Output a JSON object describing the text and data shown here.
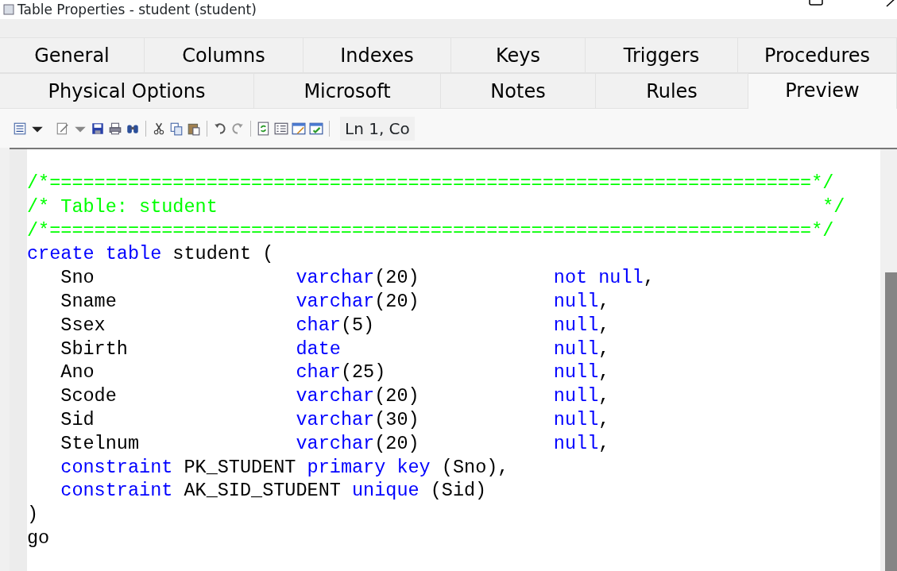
{
  "window": {
    "title": "Table Properties - student (student)"
  },
  "tab_rows": [
    [
      {
        "label": "General",
        "selected": false
      },
      {
        "label": "Columns",
        "selected": false
      },
      {
        "label": "Indexes",
        "selected": false
      },
      {
        "label": "Keys",
        "selected": false
      },
      {
        "label": "Triggers",
        "selected": false
      },
      {
        "label": "Procedures",
        "selected": false
      }
    ],
    [
      {
        "label": "Physical Options",
        "selected": false
      },
      {
        "label": "Microsoft",
        "selected": false
      },
      {
        "label": "Notes",
        "selected": false
      },
      {
        "label": "Rules",
        "selected": false
      },
      {
        "label": "Preview",
        "selected": true
      }
    ]
  ],
  "toolbar": {
    "position": "Ln 1, Co"
  },
  "code_lines": [
    [
      {
        "kind": "comment",
        "text": "/*====================================================================*/"
      }
    ],
    [
      {
        "kind": "comment",
        "text": "/* Table: student                                                      */"
      }
    ],
    [
      {
        "kind": "comment",
        "text": "/*====================================================================*/"
      }
    ],
    [
      {
        "kind": "keyword",
        "text": "create table"
      },
      {
        "kind": "plain",
        "text": " student ("
      }
    ],
    [
      {
        "kind": "plain",
        "text": "   Sno                  "
      },
      {
        "kind": "keyword",
        "text": "varchar"
      },
      {
        "kind": "plain",
        "text": "(20)            "
      },
      {
        "kind": "keyword",
        "text": "not null"
      },
      {
        "kind": "plain",
        "text": ","
      }
    ],
    [
      {
        "kind": "plain",
        "text": "   Sname                "
      },
      {
        "kind": "keyword",
        "text": "varchar"
      },
      {
        "kind": "plain",
        "text": "(20)            "
      },
      {
        "kind": "keyword",
        "text": "null"
      },
      {
        "kind": "plain",
        "text": ","
      }
    ],
    [
      {
        "kind": "plain",
        "text": "   Ssex                 "
      },
      {
        "kind": "keyword",
        "text": "char"
      },
      {
        "kind": "plain",
        "text": "(5)                "
      },
      {
        "kind": "keyword",
        "text": "null"
      },
      {
        "kind": "plain",
        "text": ","
      }
    ],
    [
      {
        "kind": "plain",
        "text": "   Sbirth               "
      },
      {
        "kind": "keyword",
        "text": "date                   null"
      },
      {
        "kind": "plain",
        "text": ","
      }
    ],
    [
      {
        "kind": "plain",
        "text": "   Ano                  "
      },
      {
        "kind": "keyword",
        "text": "char"
      },
      {
        "kind": "plain",
        "text": "(25)               "
      },
      {
        "kind": "keyword",
        "text": "null"
      },
      {
        "kind": "plain",
        "text": ","
      }
    ],
    [
      {
        "kind": "plain",
        "text": "   Scode                "
      },
      {
        "kind": "keyword",
        "text": "varchar"
      },
      {
        "kind": "plain",
        "text": "(20)            "
      },
      {
        "kind": "keyword",
        "text": "null"
      },
      {
        "kind": "plain",
        "text": ","
      }
    ],
    [
      {
        "kind": "plain",
        "text": "   Sid                  "
      },
      {
        "kind": "keyword",
        "text": "varchar"
      },
      {
        "kind": "plain",
        "text": "(30)            "
      },
      {
        "kind": "keyword",
        "text": "null"
      },
      {
        "kind": "plain",
        "text": ","
      }
    ],
    [
      {
        "kind": "plain",
        "text": "   Stelnum              "
      },
      {
        "kind": "keyword",
        "text": "varchar"
      },
      {
        "kind": "plain",
        "text": "(20)            "
      },
      {
        "kind": "keyword",
        "text": "null"
      },
      {
        "kind": "plain",
        "text": ","
      }
    ],
    [
      {
        "kind": "keyword",
        "text": "   constraint"
      },
      {
        "kind": "plain",
        "text": " PK_STUDENT "
      },
      {
        "kind": "keyword",
        "text": "primary key"
      },
      {
        "kind": "plain",
        "text": " (Sno),"
      }
    ],
    [
      {
        "kind": "keyword",
        "text": "   constraint"
      },
      {
        "kind": "plain",
        "text": " AK_SID_STUDENT "
      },
      {
        "kind": "keyword",
        "text": "unique"
      },
      {
        "kind": "plain",
        "text": " (Sid)"
      }
    ],
    [
      {
        "kind": "plain",
        "text": ")"
      }
    ],
    [
      {
        "kind": "plain",
        "text": "go"
      }
    ]
  ]
}
